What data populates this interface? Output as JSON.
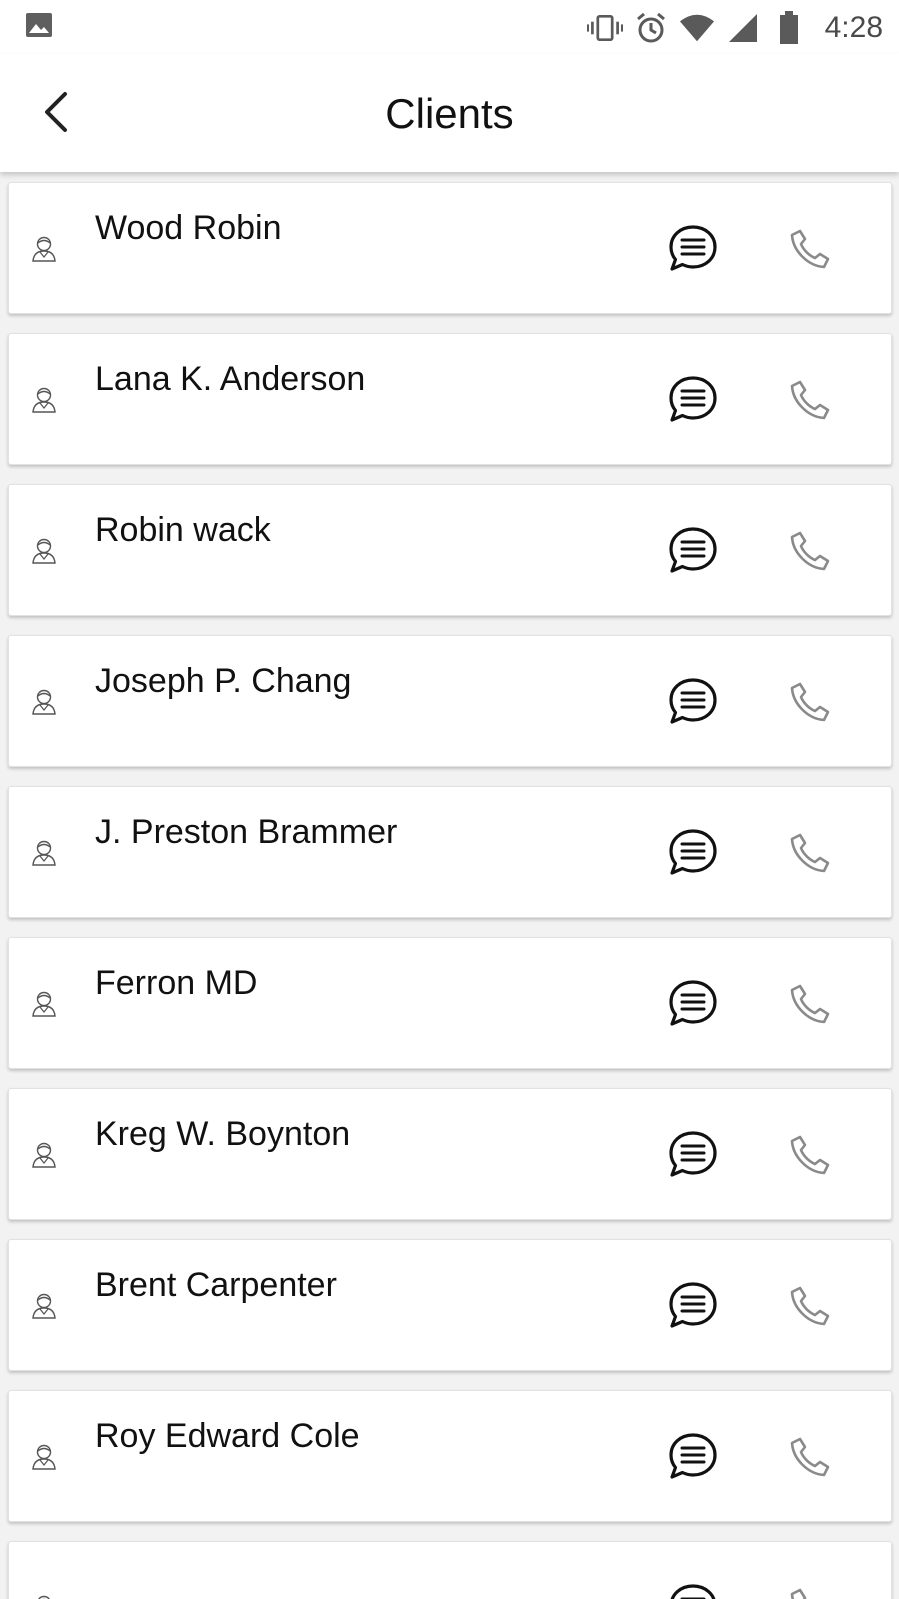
{
  "status_bar": {
    "time": "4:28",
    "icons": [
      "image-icon",
      "vibrate-icon",
      "alarm-icon",
      "wifi-icon",
      "signal-icon",
      "battery-icon"
    ]
  },
  "header": {
    "title": "Clients",
    "back_icon": "chevron-left-icon"
  },
  "clients": [
    {
      "name": "Wood Robin"
    },
    {
      "name": "Lana K. Anderson"
    },
    {
      "name": "Robin wack"
    },
    {
      "name": "Joseph P. Chang"
    },
    {
      "name": "J. Preston Brammer"
    },
    {
      "name": "Ferron MD"
    },
    {
      "name": "Kreg W. Boynton"
    },
    {
      "name": "Brent Carpenter"
    },
    {
      "name": "Roy Edward Cole"
    },
    {
      "name": ""
    }
  ],
  "row_icons": {
    "avatar": "user-icon",
    "message": "message-icon",
    "call": "phone-icon"
  },
  "colors": {
    "background": "#f2f2f2",
    "card": "#ffffff",
    "text": "#111111",
    "phone_icon": "#8a8a8a"
  }
}
